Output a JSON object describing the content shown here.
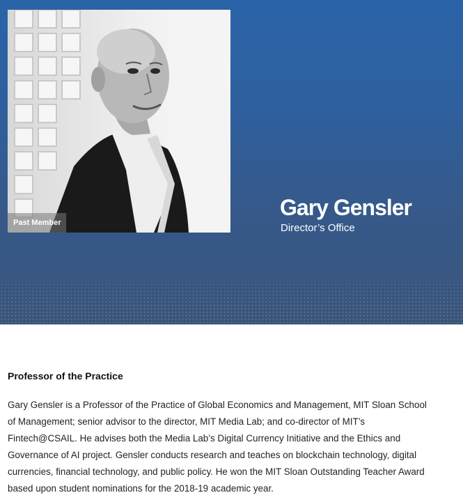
{
  "profile": {
    "status_badge": "Past Member",
    "name": "Gary Gensler",
    "department": "Director’s Office"
  },
  "main": {
    "title": "Professor of the Practice",
    "bio": "Gary Gensler is a Professor of the Practice of Global Economics and Management, MIT Sloan School of Management; senior advisor to the director, MIT Media Lab; and co-director of MIT’s Fintech@CSAIL. He advises both the Media Lab’s Digital Currency Initiative and the Ethics and Governance of AI project. Gensler conducts research and teaches on blockchain technology, digital currencies, financial technology, and public policy. He won the MIT Sloan Outstanding Teacher Award based upon student nominations for the 2018-19 academic year."
  },
  "colors": {
    "hero_top": "#2a64a8",
    "hero_bottom": "#3a5478"
  }
}
